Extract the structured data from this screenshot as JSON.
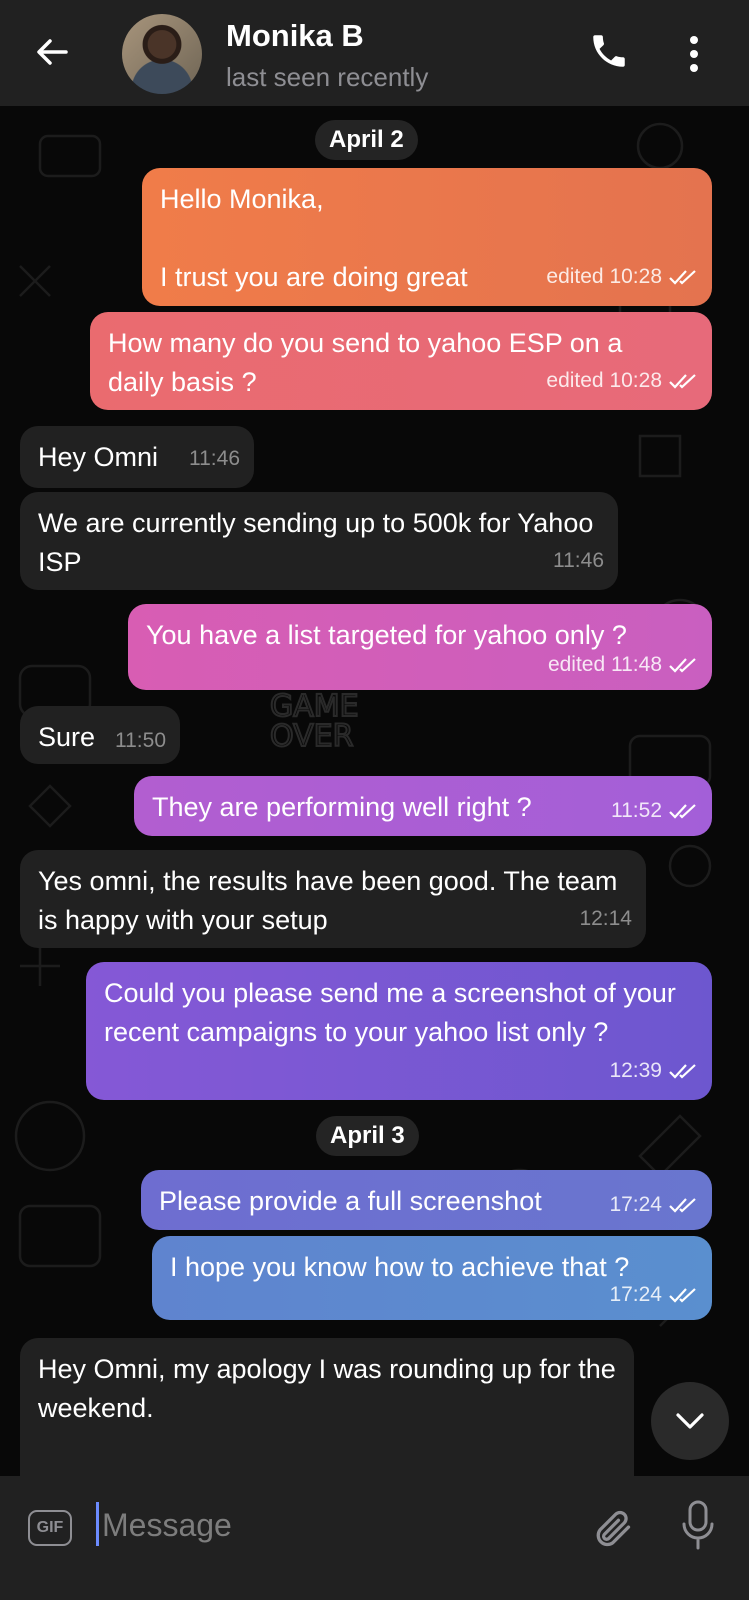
{
  "header": {
    "name": "Monika B",
    "status": "last seen recently"
  },
  "dates": [
    "April 2",
    "April 3"
  ],
  "messages": [
    {
      "dir": "out",
      "text": "Hello Monika,\n\nI trust you are doing great",
      "meta": "edited 10:28",
      "read": true
    },
    {
      "dir": "out",
      "text": "How many do you send to yahoo ESP on a daily basis ?",
      "meta": "edited 10:28",
      "read": true
    },
    {
      "dir": "in",
      "text": "Hey Omni",
      "meta": "11:46"
    },
    {
      "dir": "in",
      "text": "We are currently sending up to 500k for Yahoo ISP",
      "meta": "11:46"
    },
    {
      "dir": "out",
      "text": "You have a list targeted for yahoo only ?",
      "meta": "edited 11:48",
      "read": true
    },
    {
      "dir": "in",
      "text": "Sure",
      "meta": "11:50"
    },
    {
      "dir": "out",
      "text": "They are performing well right ?",
      "meta": "11:52",
      "read": true
    },
    {
      "dir": "in",
      "text": "Yes omni, the results have been good. The team is happy with your setup",
      "meta": "12:14"
    },
    {
      "dir": "out",
      "text": "Could you please send me a screenshot of your recent campaigns to your yahoo list only ?",
      "meta": "12:39",
      "read": true
    },
    {
      "dir": "out",
      "text": "Please provide a full screenshot",
      "meta": "17:24",
      "read": true
    },
    {
      "dir": "out",
      "text": "I hope you know how to achieve that ?",
      "meta": "17:24",
      "read": true
    },
    {
      "dir": "in",
      "text": "Hey Omni, my apology I was rounding up for the weekend.",
      "meta": ""
    }
  ],
  "composer": {
    "gif_label": "GIF",
    "placeholder": "Message"
  },
  "icons": {
    "back": "arrow-left-icon",
    "call": "phone-icon",
    "menu": "more-vertical-icon",
    "scroll": "chevron-down-icon",
    "attach": "paperclip-icon",
    "mic": "microphone-icon",
    "read": "double-check-icon"
  }
}
